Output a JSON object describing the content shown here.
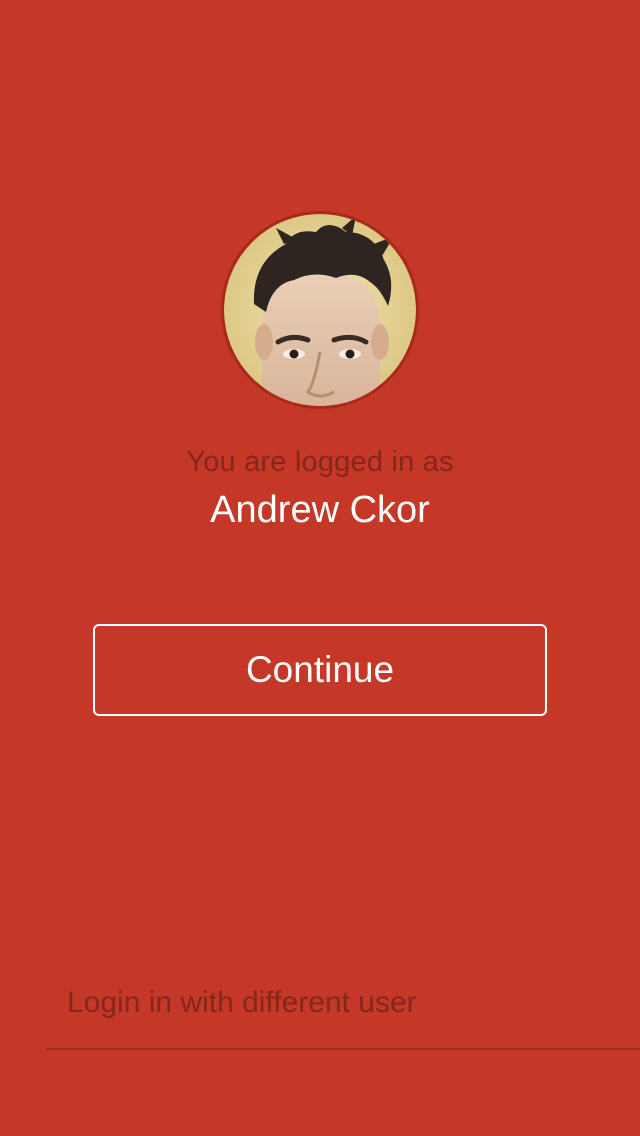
{
  "login": {
    "status_label": "You are logged in as",
    "user_name": "Andrew Ckor",
    "continue_label": "Continue",
    "other_user_label": "Login in with different user"
  },
  "avatar": {
    "icon": "user-photo-avatar"
  },
  "colors": {
    "background": "#c53726",
    "muted_text": "#84271c",
    "primary_text": "#ffffff",
    "divider": "#a12d20"
  }
}
